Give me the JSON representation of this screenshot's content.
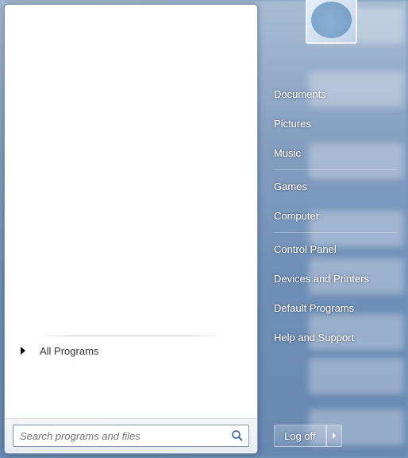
{
  "left": {
    "all_programs_label": "All Programs",
    "search": {
      "placeholder": "Search programs and files"
    }
  },
  "right": {
    "items": [
      {
        "label": "Documents"
      },
      {
        "label": "Pictures"
      },
      {
        "label": "Music"
      },
      {
        "label": "Games"
      },
      {
        "label": "Computer"
      },
      {
        "label": "Control Panel"
      },
      {
        "label": "Devices and Printers"
      },
      {
        "label": "Default Programs"
      },
      {
        "label": "Help and Support"
      }
    ],
    "logoff_label": "Log off"
  }
}
